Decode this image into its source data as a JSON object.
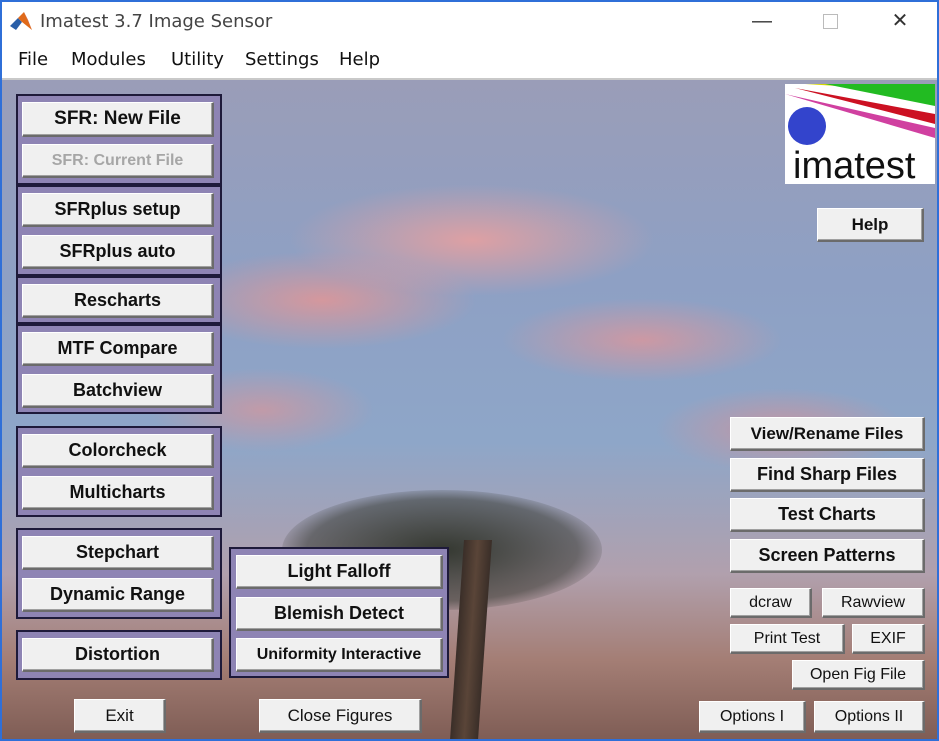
{
  "window": {
    "title": "Imatest 3.7  Image Sensor"
  },
  "menu": [
    "File",
    "Modules",
    "Utility",
    "Settings",
    "Help"
  ],
  "logo": {
    "text": "imatest",
    "colors": [
      "#e0e000",
      "#00c000",
      "#d00000",
      "#d040a0"
    ]
  },
  "left_buttons": {
    "sfr_new": "SFR: New File",
    "sfr_current": "SFR: Current File",
    "sfrplus_setup": "SFRplus  setup",
    "sfrplus_auto": "SFRplus  auto",
    "rescharts": "Rescharts",
    "mtf_compare": "MTF Compare",
    "batchview": "Batchview",
    "colorcheck": "Colorcheck",
    "multicharts": "Multicharts",
    "stepchart": "Stepchart",
    "dynamic_range": "Dynamic Range",
    "distortion": "Distortion"
  },
  "middle_buttons": {
    "light_falloff": "Light Falloff",
    "blemish_detect": "Blemish Detect",
    "uniformity_interactive": "Uniformity Interactive"
  },
  "right_buttons": {
    "help": "Help",
    "view_rename": "View/Rename Files",
    "find_sharp": "Find Sharp Files",
    "test_charts": "Test Charts",
    "screen_patterns": "Screen Patterns",
    "dcraw": "dcraw",
    "rawview": "Rawview",
    "print_test": "Print Test",
    "exif": "EXIF",
    "open_fig": "Open Fig File",
    "options1": "Options I",
    "options2": "Options II"
  },
  "bottom_buttons": {
    "exit": "Exit",
    "close_figures": "Close Figures"
  },
  "colors": {
    "group_bg": "#8e84b4",
    "group_border": "#1e1a3a",
    "button_bg": "#f0f0f0",
    "titlebar_accent": "#2f6fd8"
  }
}
